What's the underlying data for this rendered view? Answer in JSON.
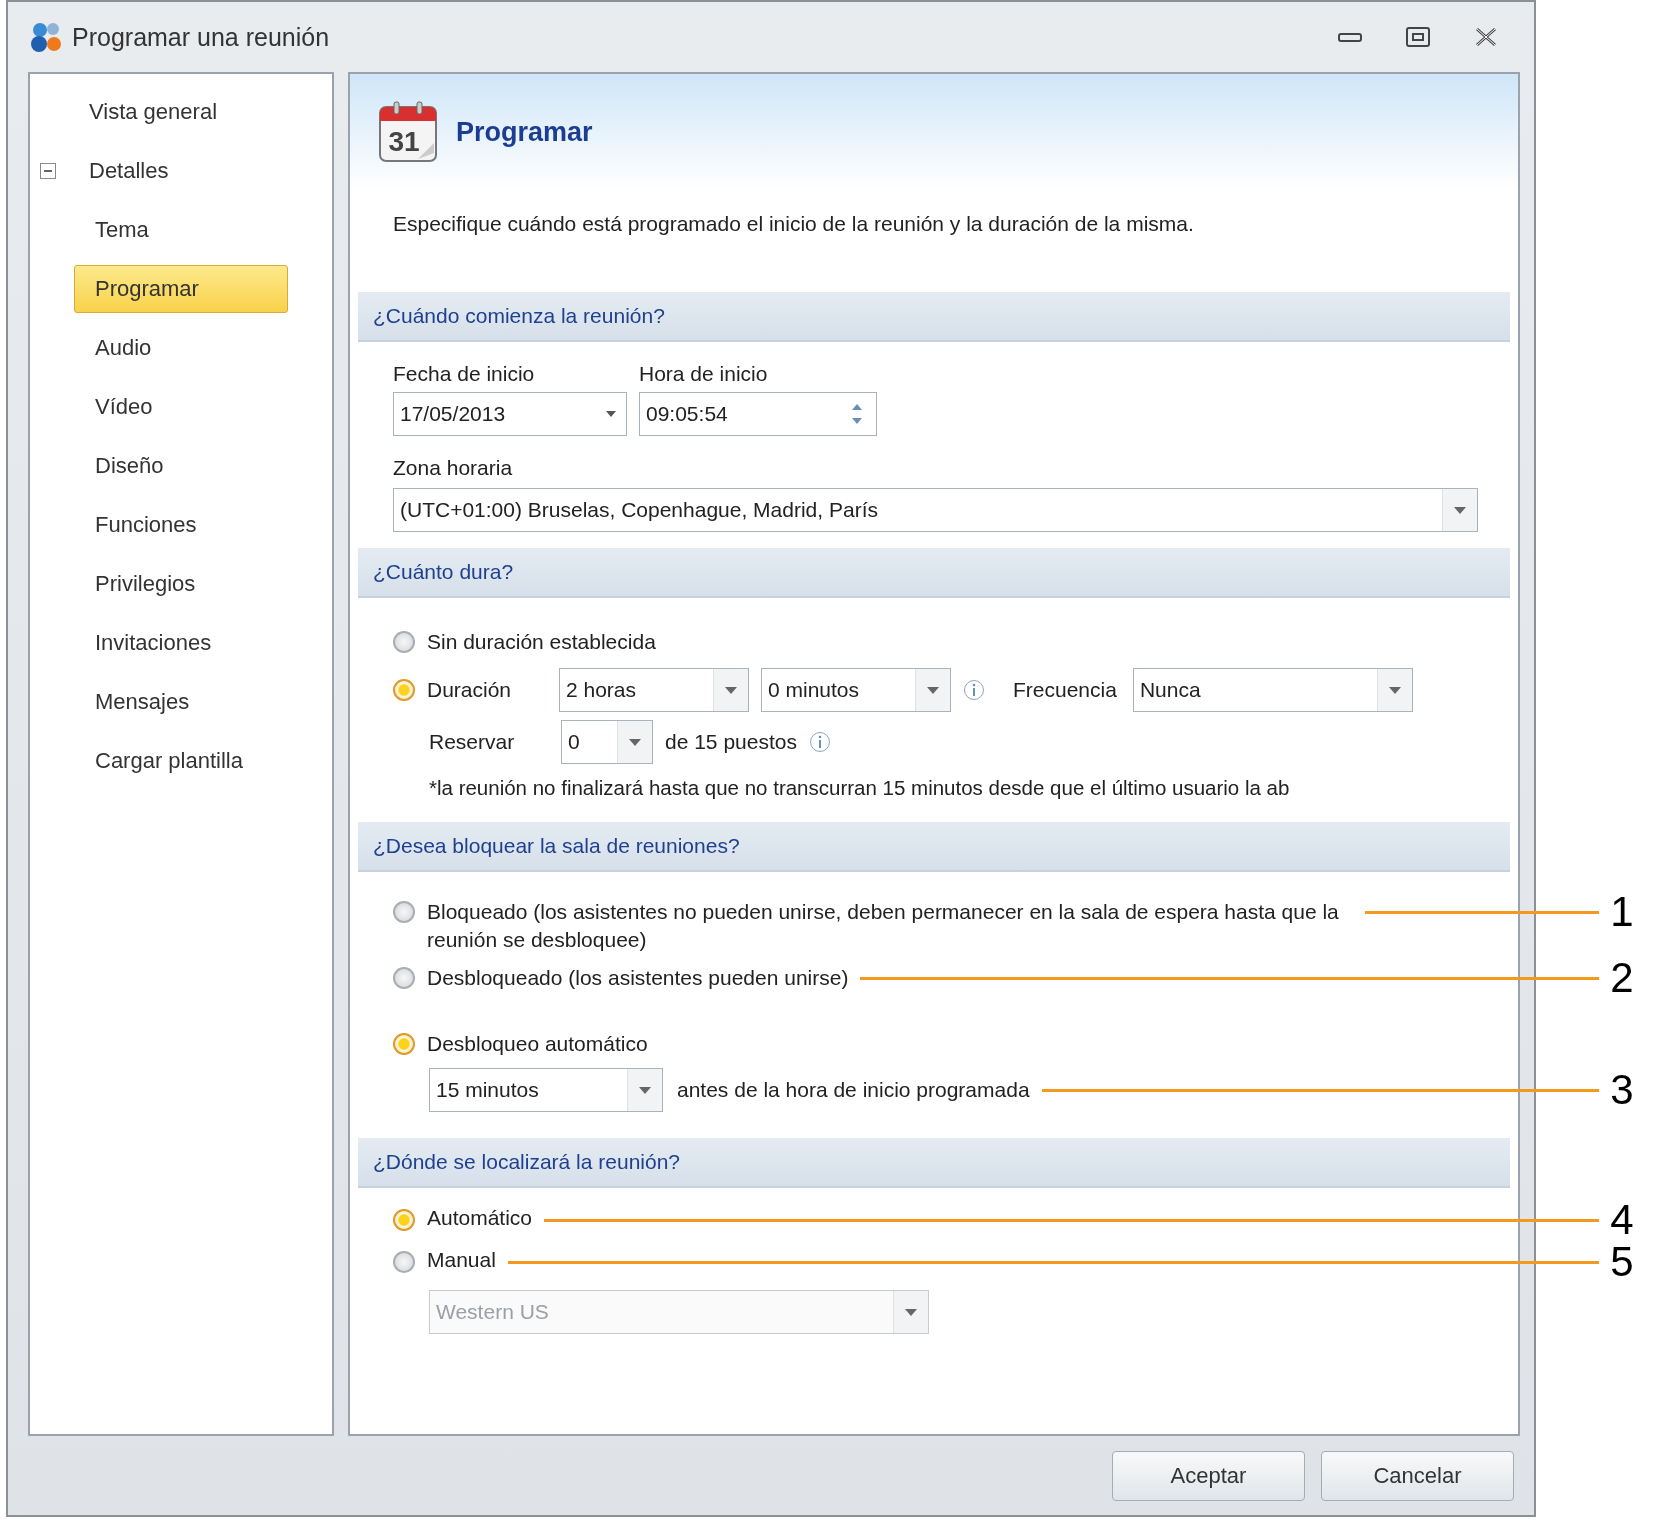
{
  "window": {
    "title": "Programar una reunión"
  },
  "sidebar": {
    "items": [
      {
        "label": "Vista general",
        "selected": false
      },
      {
        "label": "Detalles",
        "selected": false,
        "expanded": true,
        "children": [
          {
            "label": "Tema",
            "selected": false
          },
          {
            "label": "Programar",
            "selected": true
          },
          {
            "label": "Audio",
            "selected": false
          },
          {
            "label": "Vídeo",
            "selected": false
          },
          {
            "label": "Diseño",
            "selected": false
          },
          {
            "label": "Funciones",
            "selected": false
          },
          {
            "label": "Privilegios",
            "selected": false
          },
          {
            "label": "Invitaciones",
            "selected": false
          },
          {
            "label": "Mensajes",
            "selected": false
          },
          {
            "label": "Cargar plantilla",
            "selected": false
          }
        ]
      }
    ]
  },
  "header": {
    "calendar_day": "31",
    "title": "Programar",
    "description": "Especifique cuándo está programado el inicio de la reunión y la duración de la misma."
  },
  "start_section": {
    "title": "¿Cuándo comienza la reunión?",
    "date_label": "Fecha de inicio",
    "date_value": "17/05/2013",
    "time_label": "Hora de inicio",
    "time_value": "09:05:54",
    "timezone_label": "Zona horaria",
    "timezone_value": "(UTC+01:00) Bruselas, Copenhague, Madrid, París"
  },
  "duration_section": {
    "title": "¿Cuánto dura?",
    "options": [
      {
        "label": "Sin duración establecida",
        "selected": false
      },
      {
        "label": "Duración",
        "selected": true
      }
    ],
    "hours": "2 horas",
    "minutes": "0 minutos",
    "frequency_label": "Frecuencia",
    "frequency": "Nunca",
    "reserve_label": "Reservar",
    "reserve_value": "0",
    "seats_text": "de 15 puestos",
    "note": "*la reunión no finalizará hasta que no transcurran 15 minutos desde que el último usuario la ab"
  },
  "lock_section": {
    "title": "¿Desea bloquear la sala de reuniones?",
    "options": [
      {
        "label": "Bloqueado (los asistentes no pueden unirse, deben permanecer en la sala de espera hasta que la reunión se desbloquee)",
        "selected": false,
        "callout": "1"
      },
      {
        "label": "Desbloqueado (los asistentes pueden unirse)",
        "selected": false,
        "callout": "2"
      },
      {
        "label": "Desbloqueo automático",
        "selected": true
      }
    ],
    "auto_unlock_value": "15 minutos",
    "auto_unlock_suffix": "antes de la hora de inicio programada",
    "auto_unlock_callout": "3"
  },
  "location_section": {
    "title": "¿Dónde se localizará la reunión?",
    "options": [
      {
        "label": "Automático",
        "selected": true,
        "callout": "4"
      },
      {
        "label": "Manual",
        "selected": false,
        "callout": "5"
      }
    ],
    "region_value": "Western US",
    "region_disabled": true
  },
  "buttons": [
    {
      "label": "Aceptar"
    },
    {
      "label": "Cancelar"
    }
  ]
}
